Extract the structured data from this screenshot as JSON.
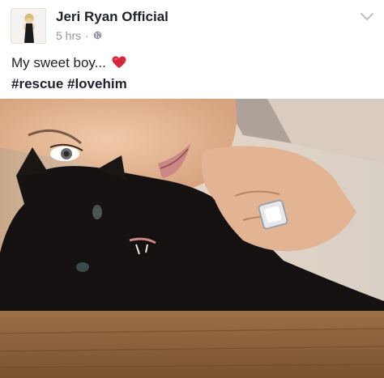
{
  "post": {
    "author": "Jeri Ryan Official",
    "time": "5 hrs",
    "separator": "·",
    "privacy_icon": "globe-icon",
    "menu_icon": "chevron-down-icon",
    "caption": "My sweet boy...",
    "caption_emoji": "heart-emoji",
    "hashtags": "#rescue #lovehim"
  },
  "colors": {
    "author_text": "#1d2129",
    "meta_text": "#90949c",
    "heart": "#d9263b"
  }
}
